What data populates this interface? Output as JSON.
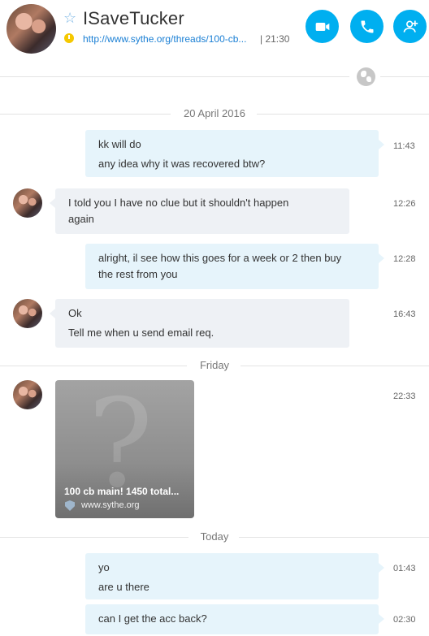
{
  "header": {
    "contact_name": "ISaveTucker",
    "mood_link": "http://www.sythe.org/threads/100-cb...",
    "mood_time": "| 21:30",
    "video_call_icon": "video-camera-icon",
    "call_icon": "phone-icon",
    "add_people_icon": "add-person-icon",
    "accent_color": "#00aff0",
    "status_color": "#f5c800"
  },
  "separators": {
    "first": "20 April 2016",
    "second": "Friday",
    "third": "Today"
  },
  "messages": [
    {
      "direction": "outgoing",
      "lines": [
        "kk will do",
        "any idea why it was recovered btw?"
      ],
      "time": "11:43"
    },
    {
      "direction": "incoming",
      "lines": [
        "I told you I have no clue but it shouldn't happen",
        "again"
      ],
      "time": "12:26"
    },
    {
      "direction": "outgoing",
      "lines": [
        "alright, il see how this goes for a week or 2 then buy",
        "the rest from you"
      ],
      "time": "12:28"
    },
    {
      "direction": "incoming",
      "lines": [
        "Ok",
        "Tell me when u send email req."
      ],
      "time": "16:43"
    },
    {
      "direction": "incoming",
      "type": "link-preview",
      "title": "100 cb main! 1450 total...",
      "domain": "www.sythe.org",
      "time": "22:33"
    },
    {
      "direction": "outgoing",
      "lines": [
        "yo",
        "are u there"
      ],
      "time": "01:43"
    },
    {
      "direction": "outgoing",
      "lines": [
        "can I get the acc back?"
      ],
      "time": "02:30"
    }
  ]
}
